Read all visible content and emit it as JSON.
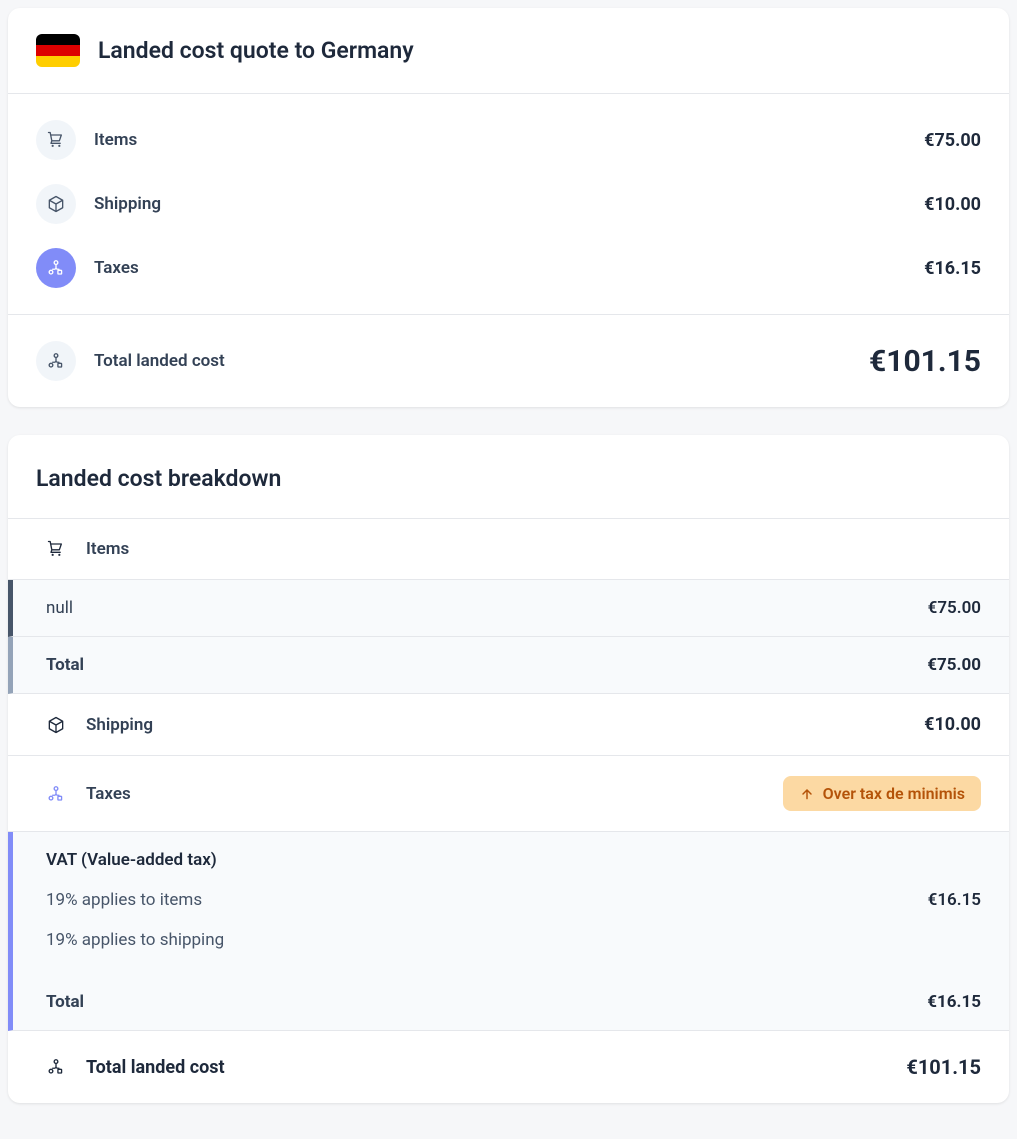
{
  "quote": {
    "title": "Landed cost quote to Germany",
    "flag": {
      "stripes": [
        "#000000",
        "#dd0000",
        "#ffce00"
      ]
    },
    "rows": [
      {
        "icon": "cart-icon",
        "label": "Items",
        "value": "€75.00"
      },
      {
        "icon": "box-icon",
        "label": "Shipping",
        "value": "€10.00"
      },
      {
        "icon": "nodes-icon",
        "label": "Taxes",
        "value": "€16.15"
      }
    ],
    "total": {
      "icon": "nodes-icon",
      "label": "Total landed cost",
      "value": "€101.15"
    }
  },
  "breakdown": {
    "title": "Landed cost breakdown",
    "items": {
      "heading": "Items",
      "lines": [
        {
          "label": "null",
          "value": "€75.00"
        }
      ],
      "total": {
        "label": "Total",
        "value": "€75.00"
      }
    },
    "shipping": {
      "heading": "Shipping",
      "value": "€10.00"
    },
    "taxes": {
      "heading": "Taxes",
      "badge": "Over tax de minimis",
      "vat": {
        "title": "VAT (Value-added tax)",
        "lines": [
          {
            "label": "19% applies to items",
            "value": "€16.15"
          },
          {
            "label": "19% applies to shipping",
            "value": ""
          }
        ]
      },
      "total": {
        "label": "Total",
        "value": "€16.15"
      }
    },
    "footer": {
      "label": "Total landed cost",
      "value": "€101.15"
    }
  }
}
